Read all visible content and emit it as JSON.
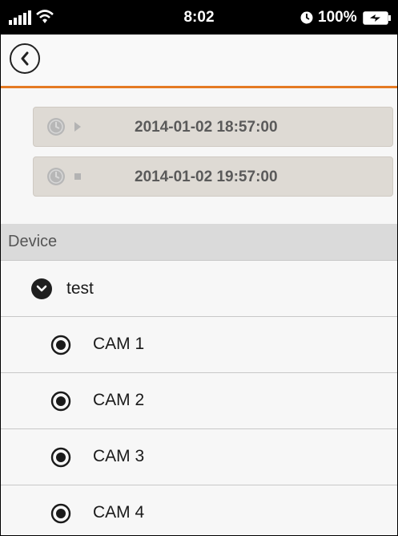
{
  "status_bar": {
    "time": "8:02",
    "battery": "100%"
  },
  "time_range": {
    "start": "2014-01-02 18:57:00",
    "end": "2014-01-02 19:57:00"
  },
  "device_section": {
    "header": "Device",
    "device_name": "test",
    "cameras": [
      "CAM 1",
      "CAM 2",
      "CAM 3",
      "CAM 4"
    ]
  },
  "colors": {
    "accent": "#e57b24"
  },
  "icons": {
    "signal": "signal-icon",
    "wifi": "wifi-icon",
    "alarm": "alarm-icon",
    "battery": "battery-icon",
    "back": "chevron-left-icon",
    "clock": "clock-icon",
    "play": "play-icon",
    "stop": "stop-icon",
    "expand": "chevron-down-icon",
    "camera": "radio-camera-icon"
  }
}
